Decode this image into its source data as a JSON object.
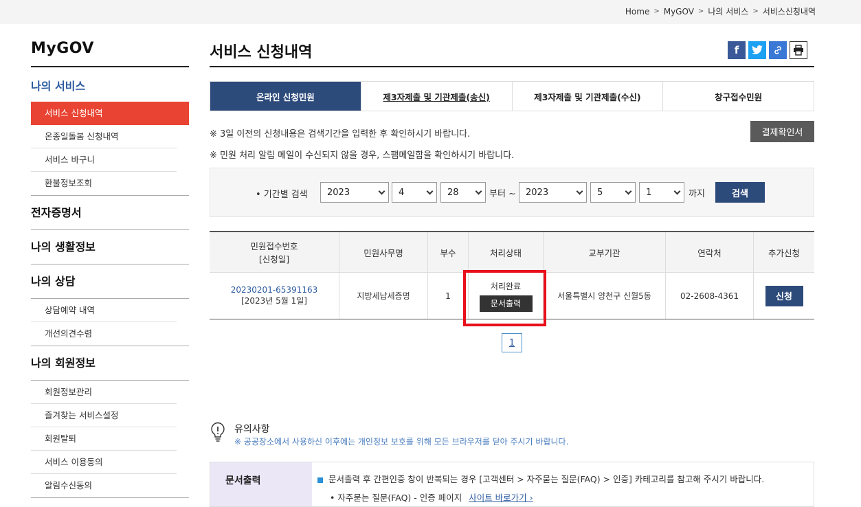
{
  "breadcrumb": [
    "Home",
    "MyGOV",
    "나의 서비스",
    "서비스신청내역"
  ],
  "sidebar": {
    "title": "MyGOV",
    "group": "나의 서비스",
    "my_service_items": [
      "서비스 신청내역",
      "온종일돌봄 신청내역",
      "서비스 바구니",
      "환불정보조회"
    ],
    "sections": {
      "cert": "전자증명서",
      "life": "나의 생활정보",
      "consult": "나의 상담",
      "member": "나의 회원정보"
    },
    "consult_items": [
      "상담예약 내역",
      "개선의견수렴"
    ],
    "member_items": [
      "회원정보관리",
      "즐겨찾는 서비스설정",
      "회원탈퇴",
      "서비스 이용동의",
      "알림수신동의"
    ]
  },
  "main": {
    "title": "서비스 신청내역",
    "tabs": [
      "온라인 신청민원",
      "제3자제출 및 기관제출(송신)",
      "제3자제출 및 기관제출(수신)",
      "창구접수민원"
    ],
    "notes": [
      "※ 3일 이전의 신청내용은 검색기간을 입력한 후 확인하시기 바랍니다.",
      "※ 민원 처리 알림 메일이 수신되지 않을 경우, 스팸메일함을 확인하시기 바랍니다."
    ],
    "approve_button": "결제확인서"
  },
  "search": {
    "label": "• 기간별 검색",
    "from_year": "2023",
    "from_month": "4",
    "from_day": "28",
    "from_text": "부터 ~",
    "to_year": "2023",
    "to_month": "5",
    "to_day": "1",
    "to_text": "까지",
    "button": "검색"
  },
  "table": {
    "headers": [
      "민원접수번호",
      "[신청일]",
      "민원사무명",
      "부수",
      "처리상태",
      "교부기관",
      "연락처",
      "추가신청"
    ],
    "row": {
      "id": "20230201-65391163",
      "date": "[2023년 5월 1일]",
      "name": "지방세납세증명",
      "count": "1",
      "status": "처리완료",
      "doc_button": "문서출력",
      "agency": "서울특별시 양천구 신월5동",
      "phone": "02-2608-4361",
      "apply_button": "신청"
    }
  },
  "pagination": {
    "current": "1"
  },
  "caution": {
    "title": "유의사항",
    "text": "※ 공공장소에서 사용하신 이후에는 개인정보 보호를 위해 모든 브라우저를 닫아 주시기 바랍니다."
  },
  "doc_print": {
    "label": "문서출력",
    "line1": "문서출력 후 간편인증 창이 반복되는 경우 [고객센터 > 자주묻는 질문(FAQ) > 인증] 카테고리를 참고해 주시기 바랍니다.",
    "line2": "• 자주묻는 질문(FAQ) - 인증 페이지",
    "link": "사이트 바로가기 ›"
  },
  "colors": {
    "accent": "#2c4a7a",
    "active_nav": "#e94433",
    "highlight": "#e8101a"
  }
}
